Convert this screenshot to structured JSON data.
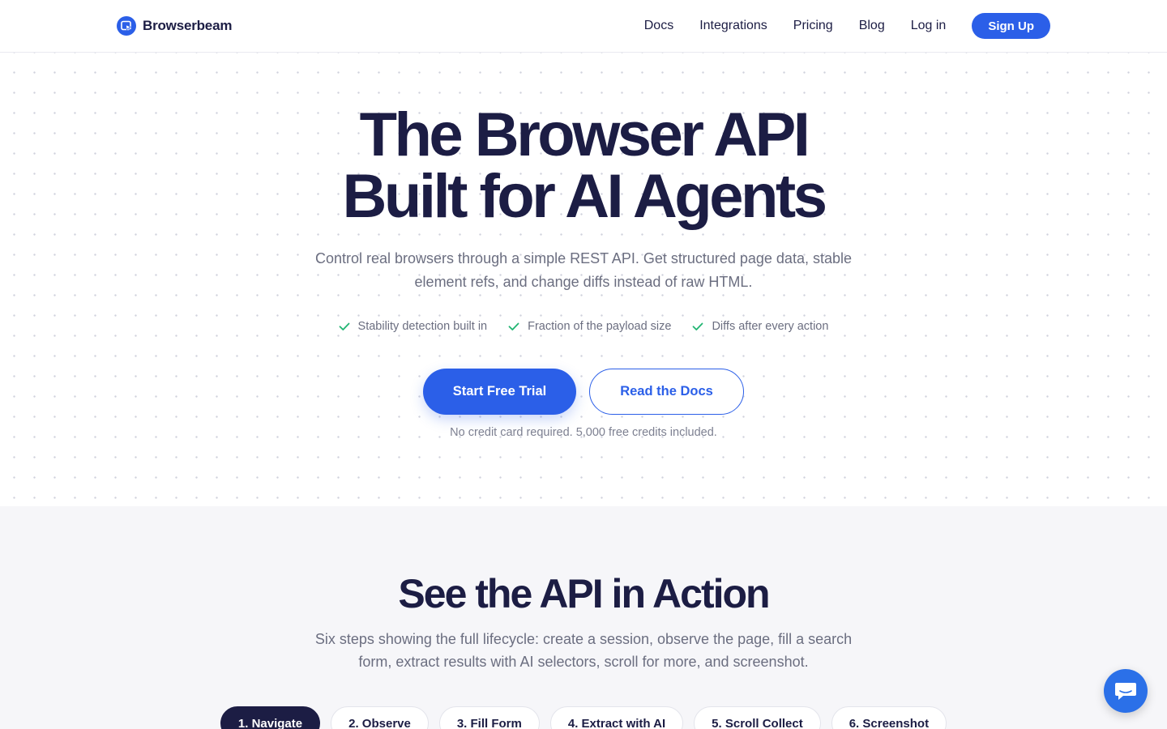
{
  "brand": {
    "name": "Browserbeam",
    "logo_icon": "browser-pointer-icon",
    "accent": "#2b5fe8"
  },
  "nav": {
    "links": [
      "Docs",
      "Integrations",
      "Pricing",
      "Blog",
      "Log in"
    ],
    "signup_label": "Sign Up"
  },
  "hero": {
    "title_line1": "The Browser API",
    "title_line2": "Built for AI Agents",
    "subtitle": "Control real browsers through a simple REST API. Get structured page data, stable element refs, and change diffs instead of raw HTML.",
    "features": [
      "Stability detection built in",
      "Fraction of the payload size",
      "Diffs after every action"
    ],
    "primary_cta": "Start Free Trial",
    "secondary_cta": "Read the Docs",
    "note": "No credit card required. 5,000 free credits included."
  },
  "demo": {
    "title": "See the API in Action",
    "subtitle": "Six steps showing the full lifecycle: create a session, observe the page, fill a search form, extract results with AI selectors, scroll for more, and screenshot.",
    "tabs": [
      "1. Navigate",
      "2. Observe",
      "3. Fill Form",
      "4. Extract with AI",
      "5. Scroll Collect",
      "6. Screenshot"
    ],
    "active_tab": 0
  },
  "chat": {
    "icon": "chat-bubble-icon",
    "color": "#2b70e8"
  }
}
